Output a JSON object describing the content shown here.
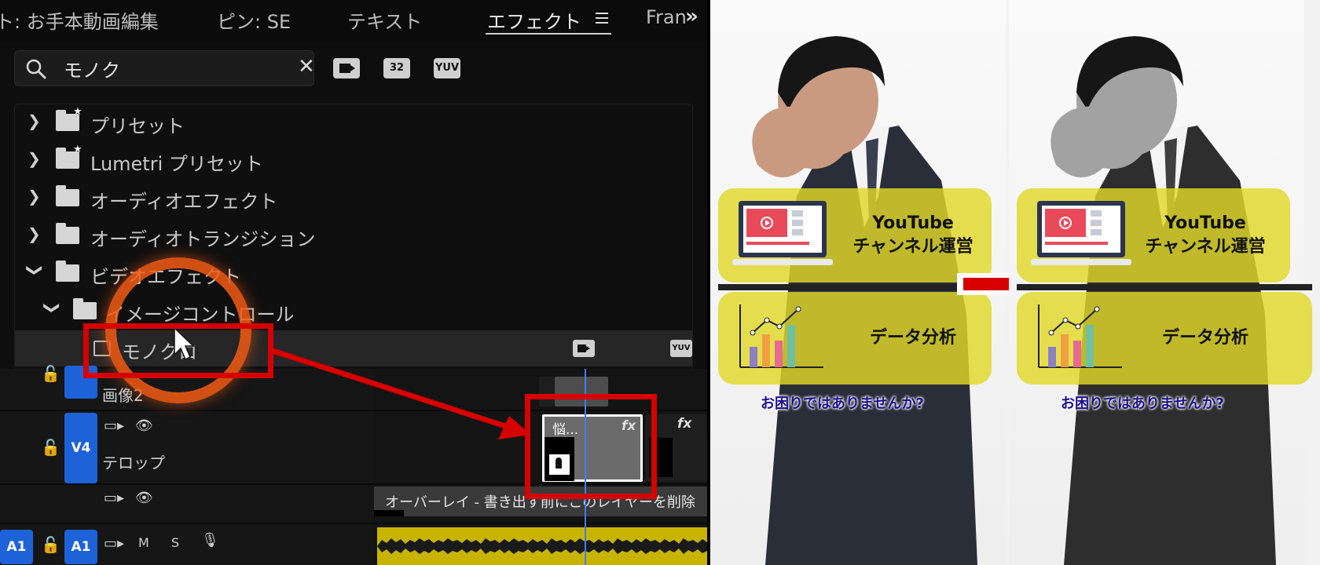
{
  "panel": {
    "tabs": {
      "project": "ト: お手本動画編集",
      "pin": "ピン: SE",
      "text": "テキスト",
      "effects": "エフェクト",
      "frame": "Fran"
    },
    "search": {
      "value": "モノク"
    },
    "filter_buttons": {
      "accelerated": "",
      "bit32": "32",
      "yuv": "YUV"
    },
    "tree": {
      "presets": "プリセット",
      "lumetri_presets": "Lumetri プリセット",
      "audio_effects": "オーディオエフェクト",
      "audio_transitions": "オーディオトランジション",
      "video_effects": "ビデオエフェクト",
      "image_control": "イメージコントロール",
      "monochrome": "モノクロ"
    },
    "row_badges": {
      "accelerated": "",
      "yuv": "YUV"
    }
  },
  "timeline": {
    "tracks": {
      "v5_name": "画像2",
      "v4_badge": "V4",
      "v4_name": "テロップ",
      "a1_source": "A1",
      "a1_target": "A1",
      "m": "M",
      "s": "S"
    },
    "clips": {
      "selected_clip_title": "悩...",
      "fx": "fx",
      "overlay_text": "オーバーレイ - 書き出す前にこのレイヤーを削除"
    }
  },
  "preview": {
    "card_youtube_line1": "YouTube",
    "card_youtube_line2": "チャンネル運営",
    "card_data": "データ分析",
    "caption": "お困りではありませんか?"
  },
  "colors": {
    "accent_red": "#d60000",
    "track_blue": "#1d62d8",
    "card_yellow": "#e0d828",
    "caption_navy": "#1c0f8e",
    "audio_yellow": "#c8b400"
  }
}
